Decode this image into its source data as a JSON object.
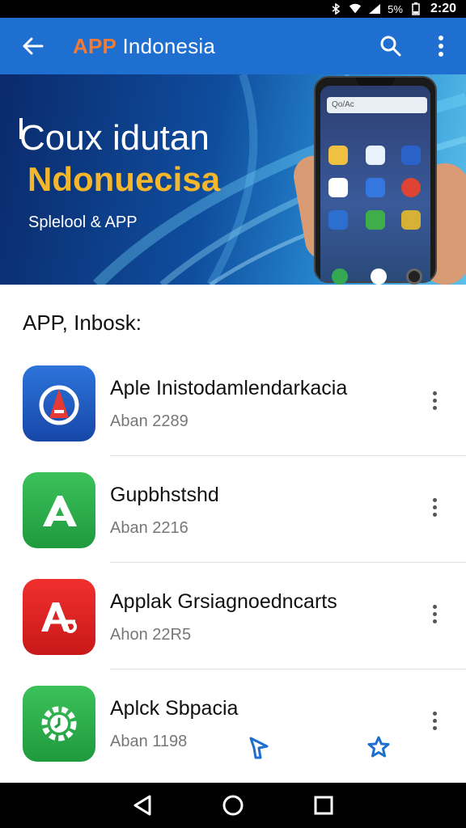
{
  "status_bar": {
    "battery_text": "5%",
    "time": "2:20"
  },
  "app_bar": {
    "title_accent": "APP",
    "title_rest": " Indonesia"
  },
  "banner": {
    "headline": "Coux idutan",
    "subheadline": "Ndonuecisa",
    "tagline": "Splelool & APP",
    "phone_search": "Qo/Ac"
  },
  "section": {
    "title": "APP, Inbosk:"
  },
  "apps": [
    {
      "name": "Aple Inistodamlendarkacia",
      "meta": "Aban 2289",
      "color": "#1c5bc2",
      "icon": "a-logo-icon"
    },
    {
      "name": "Gupbhstshd",
      "meta": "Aban 2216",
      "color": "#23a847",
      "icon": "a-triangle-icon"
    },
    {
      "name": "Applak Grsiagnoedncarts",
      "meta": "Ahon 22R5",
      "color": "#e82626",
      "icon": "ab-logo-icon"
    },
    {
      "name": "Aplck Sbpacia",
      "meta": "Aban 1198",
      "color": "#26a94a",
      "icon": "gear-clock-icon"
    }
  ],
  "colors": {
    "app_bar": "#1e6fd0",
    "accent": "#f07a36",
    "banner_yellow": "#f4b62b"
  }
}
